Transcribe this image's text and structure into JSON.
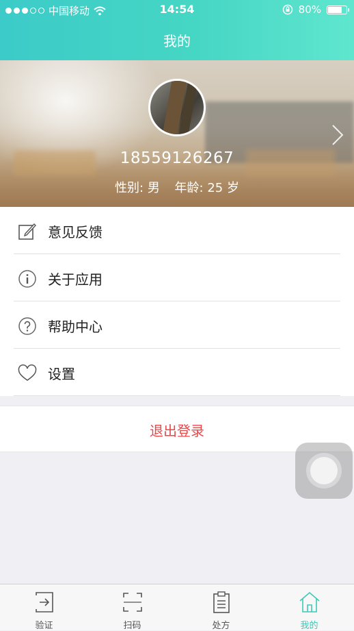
{
  "status_bar": {
    "carrier": "中国移动",
    "time": "14:54",
    "battery": "80%",
    "battery_level": 0.8
  },
  "nav": {
    "title": "我的"
  },
  "profile": {
    "phone": "18559126267",
    "gender_label": "性别:",
    "gender": "男",
    "age_label": "年龄:",
    "age": "25",
    "age_unit": "岁"
  },
  "menu": {
    "items": [
      {
        "label": "意见反馈",
        "icon": "edit-icon"
      },
      {
        "label": "关于应用",
        "icon": "info-icon"
      },
      {
        "label": "帮助中心",
        "icon": "help-icon"
      },
      {
        "label": "设置",
        "icon": "heart-icon"
      }
    ]
  },
  "logout": {
    "label": "退出登录"
  },
  "tabbar": {
    "tabs": [
      {
        "label": "验证",
        "icon": "login-icon"
      },
      {
        "label": "扫码",
        "icon": "scan-icon"
      },
      {
        "label": "处方",
        "icon": "clipboard-icon"
      },
      {
        "label": "我的",
        "icon": "home-icon",
        "active": true
      }
    ]
  },
  "colors": {
    "header_start": "#3ccbc8",
    "header_end": "#5fe6cf",
    "logout_text": "#e8474a",
    "tab_active": "#3dc9b6"
  }
}
